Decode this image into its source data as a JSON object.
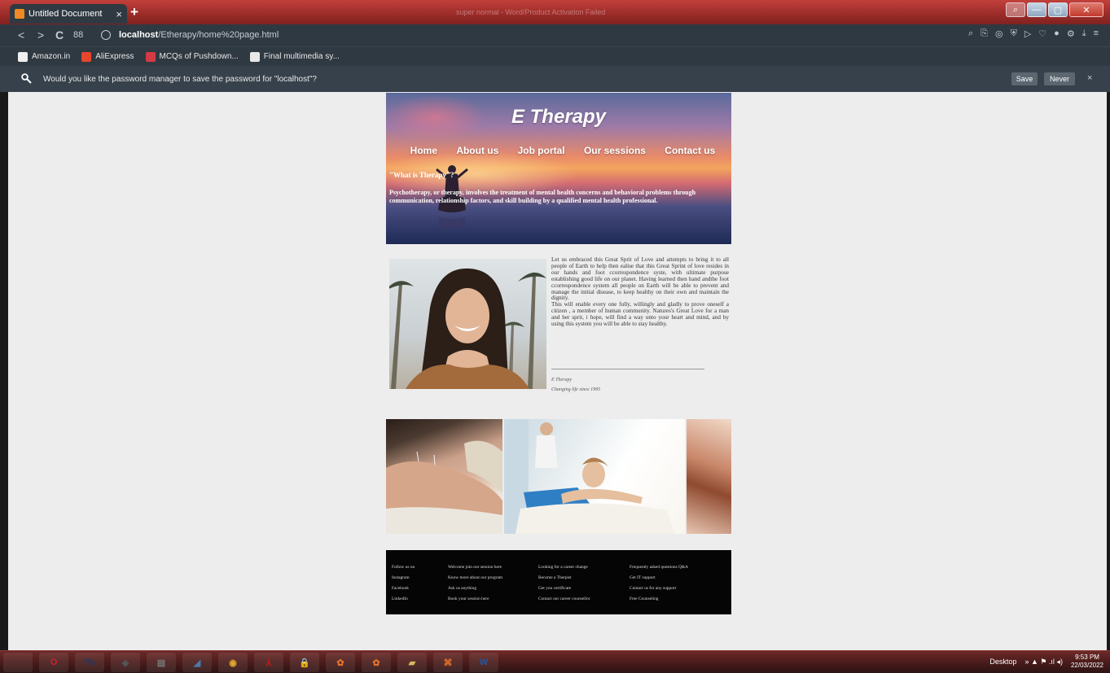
{
  "browser": {
    "tab_title": "Untitled Document",
    "tab_close": "×",
    "new_tab": "+",
    "window_title": "super normal - Word/Product Activation Failed",
    "window_controls": {
      "minimize": "—",
      "maximize": "▢",
      "close": "✕",
      "search": "⌕"
    },
    "nav": {
      "back": "<",
      "forward": ">",
      "reload": "C",
      "grid": "88"
    },
    "url_host": "localhost",
    "url_path": "/Etherapy/home%20page.html",
    "toolbar_icons": [
      "⌕",
      "⎘",
      "◎",
      "⛨",
      "▷",
      "♡",
      "●",
      "⚙",
      "⤓",
      "≡"
    ]
  },
  "bookmarks": [
    {
      "label": "Amazon.in",
      "icon": "amazon-icon",
      "color": "#f0f0f0"
    },
    {
      "label": "AliExpress",
      "icon": "aliexpress-icon",
      "color": "#e8462c"
    },
    {
      "label": "MCQs of Pushdown...",
      "icon": "mcq-icon",
      "color": "#d43a44"
    },
    {
      "label": "Final multimedia sy...",
      "icon": "document-icon",
      "color": "#e8e8e8"
    }
  ],
  "password_bar": {
    "message": "Would you like the password manager to save the password for \"localhost\"?",
    "save": "Save",
    "never": "Never",
    "close": "×"
  },
  "hero": {
    "title": "E Therapy",
    "nav": [
      "Home",
      "About us",
      "Job portal",
      "Our sessions",
      "Contact us"
    ],
    "question": "\"What is Therapy\"?",
    "description": "Psychotherapy, or therapy, involves the treatment of mental health concerns and behavioral problems through communication, relationship factors, and skill building by a qualified mental health professional."
  },
  "about": {
    "paragraph1": "Let us embraced this Great Sprit of Love and attempts to bring it to all people of Earth to help then ealise that this Great Sprint of love resides in our hands and foot ccorrespondence syste, with ultimate purpose establishing good life on our planet. Having learned then hand andthe foot ccorrespondence system all people on Earth will be able to prevent and manage the initial disease, to keep healthy on their own and maintain the dignity.",
    "paragraph2": "This will enable every one fully, willingly and gladly to prove oneself a citizen , a member of human community. Natures's Great Love for a man and her sprit, i hope, will find a way unto your heart and mind, and by using this system you will be able to stay healthy.",
    "signature": "E Therapy",
    "tagline": "Changing life since 1995"
  },
  "footer": {
    "columns": [
      [
        "Follow us on",
        "Instagram",
        "Facebook",
        "LinkedIn"
      ],
      [
        "Welcome join our session here",
        "Know more about our program",
        "Ask us anything",
        "Book your session here"
      ],
      [
        "Looking for a career change",
        "Become a Therpist",
        "Get you certificate",
        "Contact our career counsellor"
      ],
      [
        "Frequently asked questions Q&A",
        "Get IT support",
        "Contact us for any support",
        "Free Counseling"
      ]
    ]
  },
  "taskbar": {
    "apps": [
      {
        "icon": "explorer-icon",
        "label": "",
        "color": "#e6c25a"
      },
      {
        "icon": "opera-icon",
        "label": "O",
        "color": "#d1232a"
      },
      {
        "icon": "photoshop-icon",
        "label": "Ps",
        "color": "#1f3b66"
      },
      {
        "icon": "app-icon",
        "label": "◆",
        "color": "#555555"
      },
      {
        "icon": "notepad-icon",
        "label": "▤",
        "color": "#777777"
      },
      {
        "icon": "feather-icon",
        "label": "◢",
        "color": "#4a7aa8"
      },
      {
        "icon": "chrome-icon",
        "label": "◉",
        "color": "#e0a82a"
      },
      {
        "icon": "acrobat-icon",
        "label": "⅄",
        "color": "#c41a1a"
      },
      {
        "icon": "lock-icon",
        "label": "🔒",
        "color": "#d4a000"
      },
      {
        "icon": "xampp-icon",
        "label": "✿",
        "color": "#e8742a"
      },
      {
        "icon": "xampp-icon-2",
        "label": "✿",
        "color": "#e8742a"
      },
      {
        "icon": "folder-icon",
        "label": "▰",
        "color": "#d9b85a"
      },
      {
        "icon": "dreamweaver-icon",
        "label": "⌘",
        "color": "#e8742a"
      },
      {
        "icon": "word-icon",
        "label": "W",
        "color": "#2b579a"
      }
    ],
    "desktop": "Desktop",
    "tray_icons": "» ▲ ⚑ .ıl ◂)",
    "time": "9:53 PM",
    "date": "22/03/2022"
  }
}
